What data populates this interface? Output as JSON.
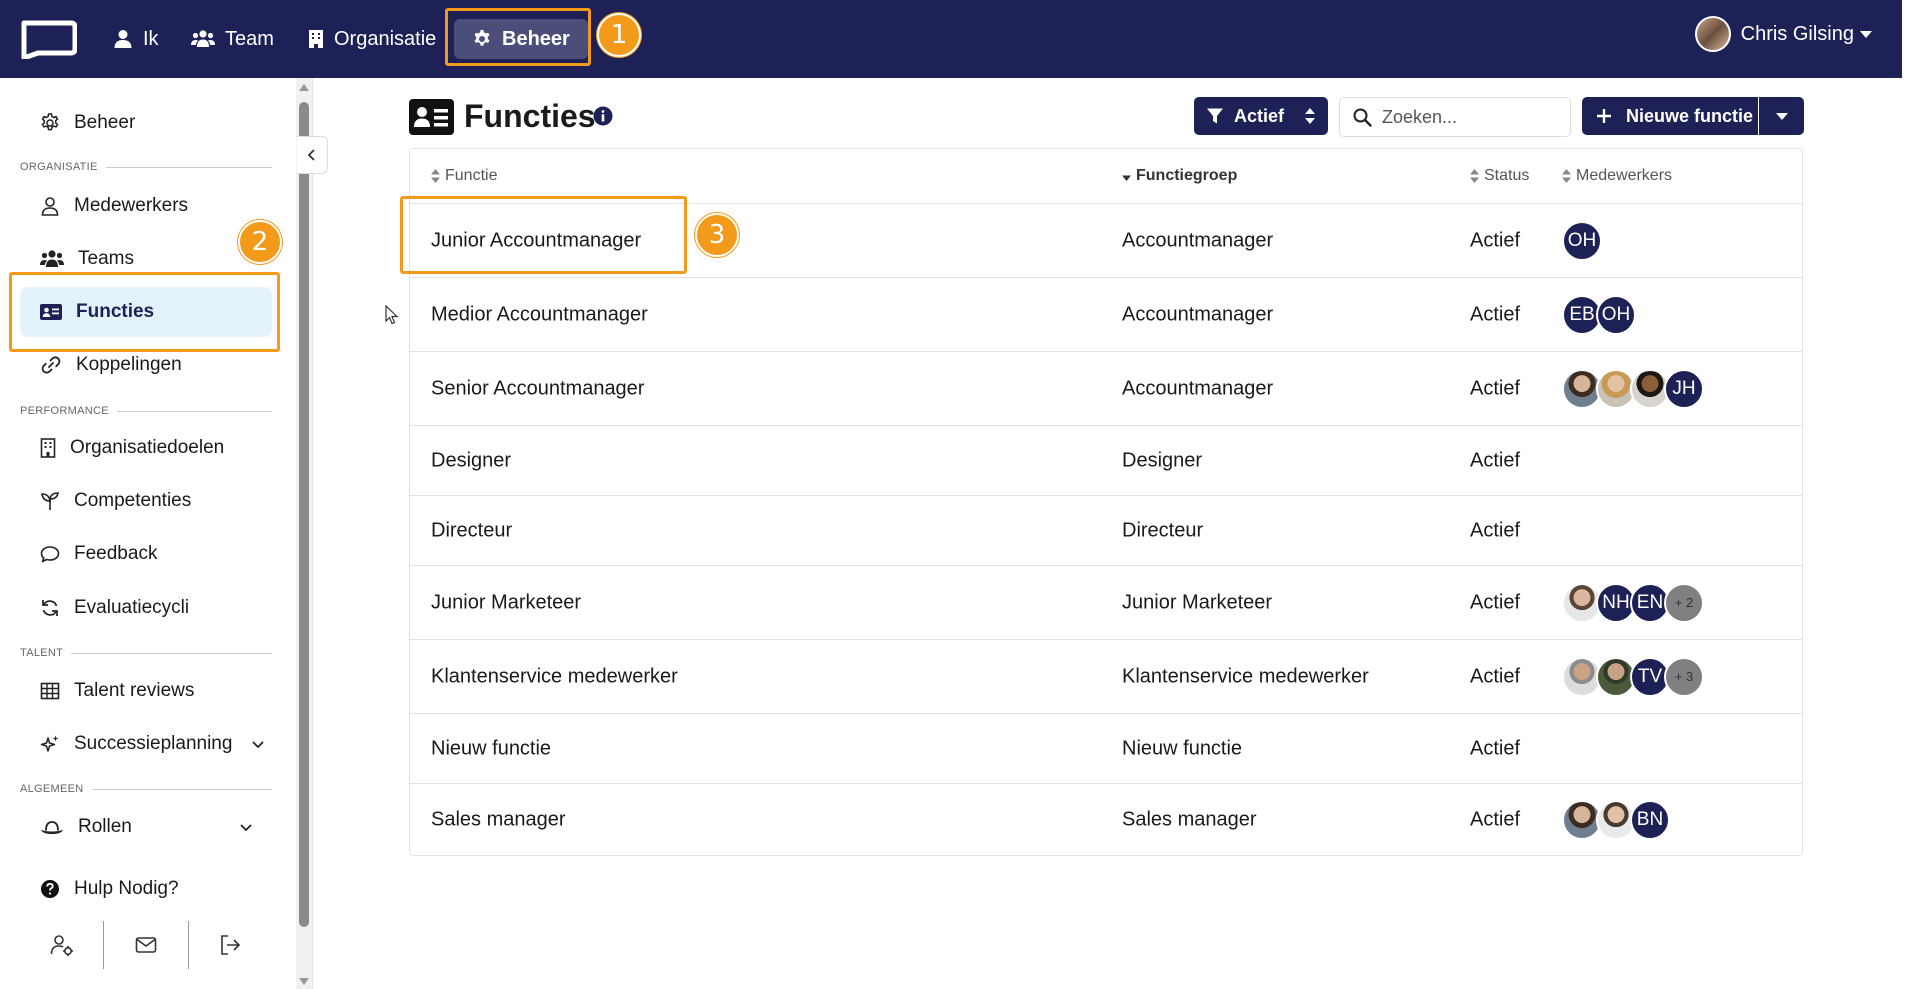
{
  "topnav": {
    "items": [
      {
        "label": "Ik",
        "icon": "user-icon"
      },
      {
        "label": "Team",
        "icon": "users-icon"
      },
      {
        "label": "Organisatie",
        "icon": "building-icon"
      },
      {
        "label": "Beheer",
        "icon": "gear-icon",
        "active": true
      }
    ],
    "user_name": "Chris Gilsing"
  },
  "callouts": [
    "1",
    "2",
    "3"
  ],
  "sidebar": {
    "top_item": {
      "label": "Beheer",
      "icon": "gear-icon"
    },
    "sections": [
      {
        "title": "ORGANISATIE",
        "items": [
          {
            "label": "Medewerkers",
            "icon": "user-icon"
          },
          {
            "label": "Teams",
            "icon": "users-icon"
          },
          {
            "label": "Functies",
            "icon": "id-card-icon",
            "active": true
          },
          {
            "label": "Koppelingen",
            "icon": "link-icon"
          }
        ]
      },
      {
        "title": "PERFORMANCE",
        "items": [
          {
            "label": "Organisatiedoelen",
            "icon": "building-icon"
          },
          {
            "label": "Competenties",
            "icon": "seedling-icon"
          },
          {
            "label": "Feedback",
            "icon": "chat-icon"
          },
          {
            "label": "Evaluatiecycli",
            "icon": "refresh-icon"
          }
        ]
      },
      {
        "title": "TALENT",
        "items": [
          {
            "label": "Talent reviews",
            "icon": "grid-icon"
          },
          {
            "label": "Successieplanning",
            "icon": "sparkle-icon",
            "expandable": true
          }
        ]
      },
      {
        "title": "ALGEMEEN",
        "items": [
          {
            "label": "Rollen",
            "icon": "hat-icon",
            "expandable": true
          }
        ]
      }
    ],
    "help": {
      "label": "Hulp Nodig?",
      "icon": "question-icon"
    },
    "footer_icons": [
      "user-settings-icon",
      "mail-icon",
      "logout-icon"
    ]
  },
  "page": {
    "title": "Functies",
    "filter_label": "Actief",
    "search_placeholder": "Zoeken...",
    "new_button_label": "Nieuwe functie"
  },
  "table": {
    "columns": [
      "Functie",
      "Functiegroep",
      "Status",
      "Medewerkers"
    ],
    "sorted_column": "Functiegroep",
    "rows": [
      {
        "functie": "Junior Accountmanager",
        "groep": "Accountmanager",
        "status": "Actief",
        "medewerkers": [
          {
            "initials": "OH"
          }
        ]
      },
      {
        "functie": "Medior Accountmanager",
        "groep": "Accountmanager",
        "status": "Actief",
        "medewerkers": [
          {
            "initials": "EB"
          },
          {
            "initials": "OH"
          }
        ]
      },
      {
        "functie": "Senior Accountmanager",
        "groep": "Accountmanager",
        "status": "Actief",
        "medewerkers": [
          {
            "photo": "photo1"
          },
          {
            "photo": "photo2"
          },
          {
            "photo": "photo3"
          },
          {
            "initials": "JH"
          }
        ]
      },
      {
        "functie": "Designer",
        "groep": "Designer",
        "status": "Actief",
        "medewerkers": []
      },
      {
        "functie": "Directeur",
        "groep": "Directeur",
        "status": "Actief",
        "medewerkers": []
      },
      {
        "functie": "Junior Marketeer",
        "groep": "Junior Marketeer",
        "status": "Actief",
        "medewerkers": [
          {
            "photo": "photo4"
          },
          {
            "initials": "NH"
          },
          {
            "initials": "EN"
          },
          {
            "more": "+ 2"
          }
        ]
      },
      {
        "functie": "Klantenservice medewerker",
        "groep": "Klantenservice medewerker",
        "status": "Actief",
        "medewerkers": [
          {
            "photo": "photo5"
          },
          {
            "photo": "photo6"
          },
          {
            "initials": "TV"
          },
          {
            "more": "+ 3"
          }
        ]
      },
      {
        "functie": "Nieuw functie",
        "groep": "Nieuw functie",
        "status": "Actief",
        "medewerkers": []
      },
      {
        "functie": "Sales manager",
        "groep": "Sales manager",
        "status": "Actief",
        "medewerkers": [
          {
            "photo": "photo1"
          },
          {
            "photo": "photo7"
          },
          {
            "initials": "BN"
          }
        ]
      }
    ]
  },
  "colors": {
    "navy": "#1e2156",
    "nav_active": "#4b4e79",
    "highlight": "#f39a1b",
    "sidebar_active_bg": "#e3f2fb"
  }
}
